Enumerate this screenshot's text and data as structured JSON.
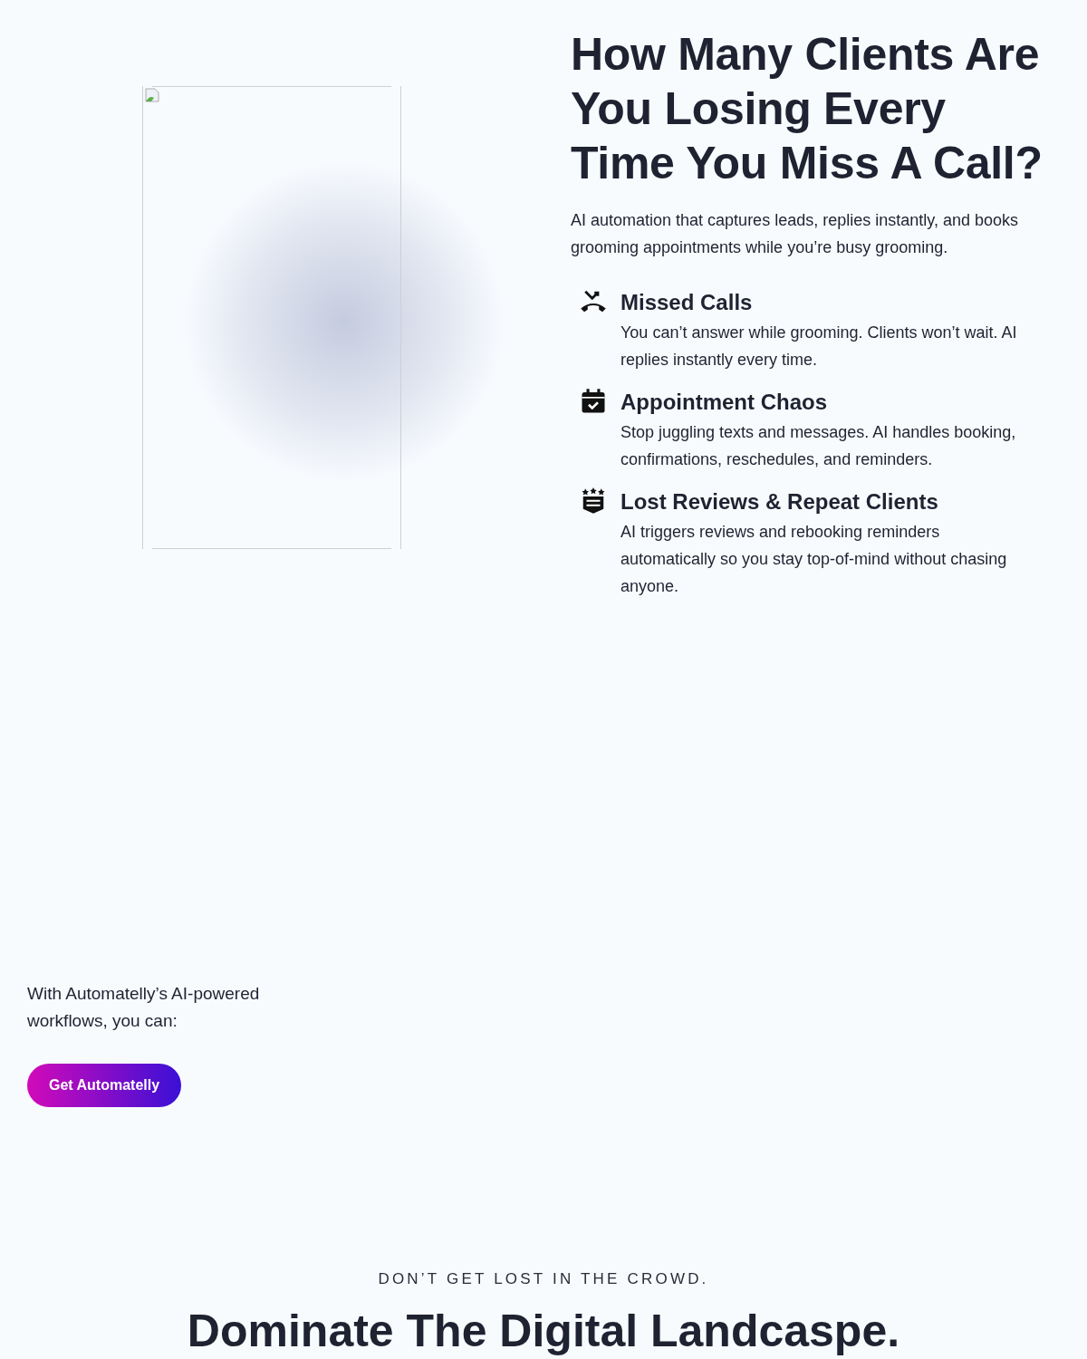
{
  "hero": {
    "heading": "How Many Clients Are You Losing Every Time You Miss A Call?",
    "intro": "AI automation that captures leads, replies instantly, and books grooming appointments while you’re busy grooming.",
    "features": [
      {
        "kind": "missed-call",
        "title": "Missed Calls",
        "text": "You can’t answer while grooming. Clients won’t wait. AI replies instantly every time."
      },
      {
        "kind": "calendar",
        "title": "Appointment Chaos",
        "text": "Stop juggling texts and messages. AI handles booking, confirmations, reschedules, and reminders."
      },
      {
        "kind": "reviews",
        "title": "Lost Reviews & Repeat Clients",
        "text": "AI triggers reviews and rebooking reminders automatically so you stay top-of-mind without chasing anyone."
      }
    ]
  },
  "workflows": {
    "text": "With Automatelly’s AI-powered workflows, you can:",
    "button": "Get Automatelly"
  },
  "section": {
    "eyebrow": "DON’T GET LOST IN THE CROWD.",
    "title": "Dominate The Digital Landcaspe."
  }
}
